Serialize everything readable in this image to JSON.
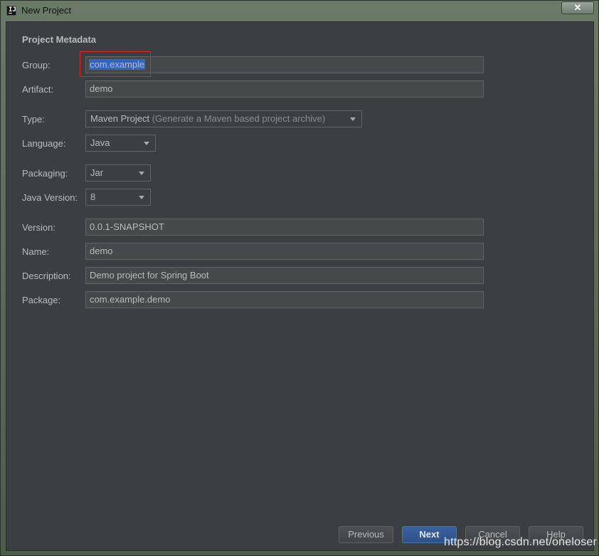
{
  "window": {
    "title": "New Project",
    "app_icon_text": "IJ",
    "close_label": "✕"
  },
  "form": {
    "section_title": "Project Metadata",
    "group": {
      "label": "Group:",
      "value": "com.example"
    },
    "artifact": {
      "label": "Artifact:",
      "value": "demo"
    },
    "type": {
      "label": "Type:",
      "value": "Maven Project",
      "hint": "(Generate a Maven based project archive)"
    },
    "language": {
      "label": "Language:",
      "value": "Java"
    },
    "packaging": {
      "label": "Packaging:",
      "value": "Jar"
    },
    "java_version": {
      "label": "Java Version:",
      "value": "8"
    },
    "version": {
      "label": "Version:",
      "value": "0.0.1-SNAPSHOT"
    },
    "name": {
      "label": "Name:",
      "value": "demo"
    },
    "description": {
      "label": "Description:",
      "value": "Demo project for Spring Boot"
    },
    "package": {
      "label": "Package:",
      "value": "com.example.demo"
    }
  },
  "buttons": {
    "previous": "Previous",
    "next": "Next",
    "cancel": "Cancel",
    "help": "Help"
  },
  "watermark": "https://blog.csdn.net/oneloser",
  "colors": {
    "dialog_bg": "#3c3f41",
    "field_bg": "#45494a",
    "text": "#bbbbbb",
    "selection": "#2f65ca",
    "highlight_box": "#e8231e",
    "primary_button": "#365880"
  }
}
